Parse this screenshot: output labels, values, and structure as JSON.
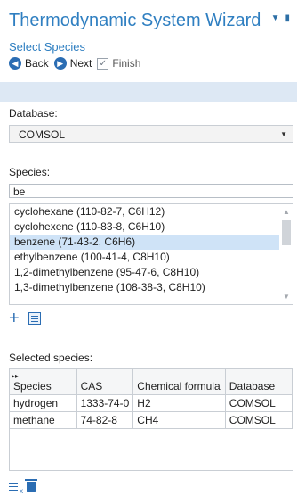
{
  "header": {
    "title": "Thermodynamic System Wizard",
    "subtitle": "Select Species",
    "back_label": "Back",
    "next_label": "Next",
    "finish_label": "Finish"
  },
  "database": {
    "label": "Database:",
    "selected": "COMSOL"
  },
  "species": {
    "label": "Species:",
    "search_value": "be",
    "items": [
      "cyclohexane (110-82-7, C6H12)",
      "cyclohexene (110-83-8, C6H10)",
      "benzene (71-43-2, C6H6)",
      "ethylbenzene (100-41-4, C8H10)",
      "1,2-dimethylbenzene (95-47-6, C8H10)",
      "1,3-dimethylbenzene (108-38-3, C8H10)"
    ],
    "selected_index": 2
  },
  "selected_species": {
    "label": "Selected species:",
    "columns": [
      "Species",
      "CAS",
      "Chemical formula",
      "Database"
    ],
    "rows": [
      [
        "hydrogen",
        "1333-74-0",
        "H2",
        "COMSOL"
      ],
      [
        "methane",
        "74-82-8",
        "CH4",
        "COMSOL"
      ]
    ]
  },
  "icons": {
    "back": "arrow-left-circle-icon",
    "next": "arrow-right-circle-icon",
    "finish": "checkbox-icon",
    "add": "plus-icon",
    "add_from_table": "table-add-icon",
    "clear": "clear-list-icon",
    "delete": "trash-icon",
    "pin": "pin-icon",
    "menu": "chevron-down-icon"
  },
  "colors": {
    "accent": "#2f7fc1",
    "selection": "#cfe3f7",
    "band": "#dde8f4"
  }
}
